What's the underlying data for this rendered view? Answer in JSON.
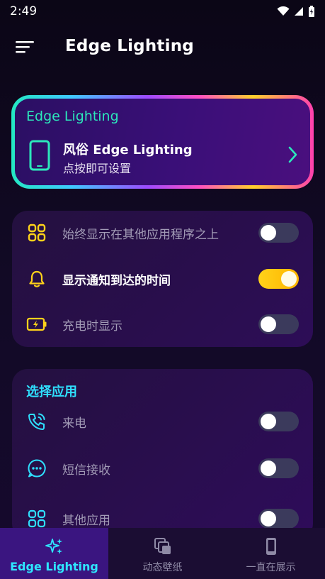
{
  "status_bar": {
    "time": "2:49",
    "icons": [
      "wifi-icon",
      "signal-icon",
      "battery-icon"
    ]
  },
  "app_bar": {
    "title": "Edge Lighting",
    "menu_icon": "menu-icon"
  },
  "hero_card": {
    "label": "Edge Lighting",
    "title": "风俗 Edge Lighting",
    "subtitle": "点按即可设置",
    "icon": "phone-icon",
    "chevron_icon": "chevron-right-icon"
  },
  "settings": {
    "rows": [
      {
        "label": "始终显示在其他应用程序之上",
        "icon": "grid-icon",
        "enabled": false
      },
      {
        "label": "显示通知到达的时间",
        "icon": "bell-icon",
        "enabled": true
      },
      {
        "label": "充电时显示",
        "icon": "battery-charging-icon",
        "enabled": false
      }
    ]
  },
  "apps": {
    "title": "选择应用",
    "rows": [
      {
        "label": "来电",
        "icon": "phone-call-icon",
        "enabled": false
      },
      {
        "label": "短信接收",
        "icon": "message-icon",
        "enabled": false
      },
      {
        "label": "其他应用",
        "icon": "grid-icon",
        "enabled": false
      }
    ]
  },
  "bottom_nav": {
    "items": [
      {
        "label": "Edge Lighting",
        "icon": "sparkle-icon",
        "active": true
      },
      {
        "label": "动态壁纸",
        "icon": "wallpaper-icon",
        "active": false
      },
      {
        "label": "一直在展示",
        "icon": "phone-icon",
        "active": false
      }
    ]
  },
  "colors": {
    "accent_green": "#2ce8bb",
    "accent_cyan": "#2fe0ff",
    "accent_yellow": "#ffd21a",
    "card_bg": "#2d0d57"
  }
}
